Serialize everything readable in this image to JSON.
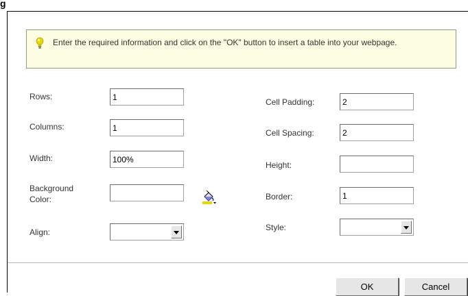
{
  "figure_label": "g",
  "info": {
    "message": "Enter the required information and click on the \"OK\" button to insert a table into your webpage."
  },
  "left": {
    "rows_label": "Rows:",
    "rows_value": "1",
    "columns_label": "Columns:",
    "columns_value": "1",
    "width_label": "Width:",
    "width_value": "100%",
    "bgcolor_label_line1": "Background",
    "bgcolor_label_line2": "Color:",
    "bgcolor_value": "",
    "align_label": "Align:",
    "align_value": ""
  },
  "right": {
    "padding_label": "Cell Padding:",
    "padding_value": "2",
    "spacing_label": "Cell Spacing:",
    "spacing_value": "2",
    "height_label": "Height:",
    "height_value": "",
    "border_label": "Border:",
    "border_value": "1",
    "style_label": "Style:",
    "style_value": ""
  },
  "buttons": {
    "ok": "OK",
    "cancel": "Cancel"
  },
  "colors": {
    "info_bg": "#fdfde3",
    "bulb": "#e8d600",
    "button_face": "#e6e6e6"
  },
  "icons": {
    "info": "lightbulb-icon",
    "color_picker": "paint-bucket-icon",
    "dropdown": "chevron-down-icon"
  }
}
